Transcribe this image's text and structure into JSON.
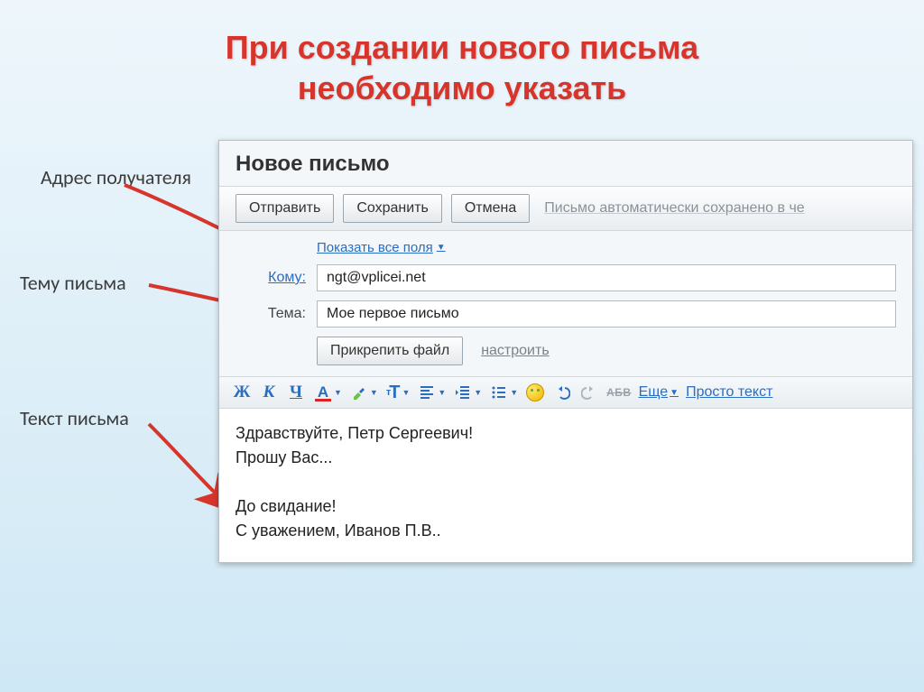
{
  "slide": {
    "title_line1": "При создании нового письма",
    "title_line2": "необходимо указать"
  },
  "labels": {
    "recipient": "Адрес получателя",
    "subject": "Тему письма",
    "body": "Текст письма"
  },
  "compose": {
    "window_title": "Новое письмо",
    "buttons": {
      "send": "Отправить",
      "save": "Сохранить",
      "cancel": "Отмена"
    },
    "autosave_text": "Письмо автоматически сохранено в че",
    "show_all_fields": "Показать все поля",
    "to_label": "Кому:",
    "to_value": "ngt@vplicei.net",
    "subject_label": "Тема:",
    "subject_value": "Мое первое письмо",
    "attach_button": "Прикрепить файл",
    "configure_link": "настроить",
    "format_toolbar": {
      "bold_glyph": "Ж",
      "italic_glyph": "К",
      "underline_glyph": "Ч",
      "color_glyph": "A",
      "smallT": "т",
      "bigT": "Т",
      "abc": "АБВ",
      "more": "Еще",
      "plain_text": "Просто текст"
    },
    "body_text": "Здравствуйте, Петр Сергеевич!\nПрошу Вас...\n\nДо свидание!\nС уважением, Иванов П.В.."
  }
}
